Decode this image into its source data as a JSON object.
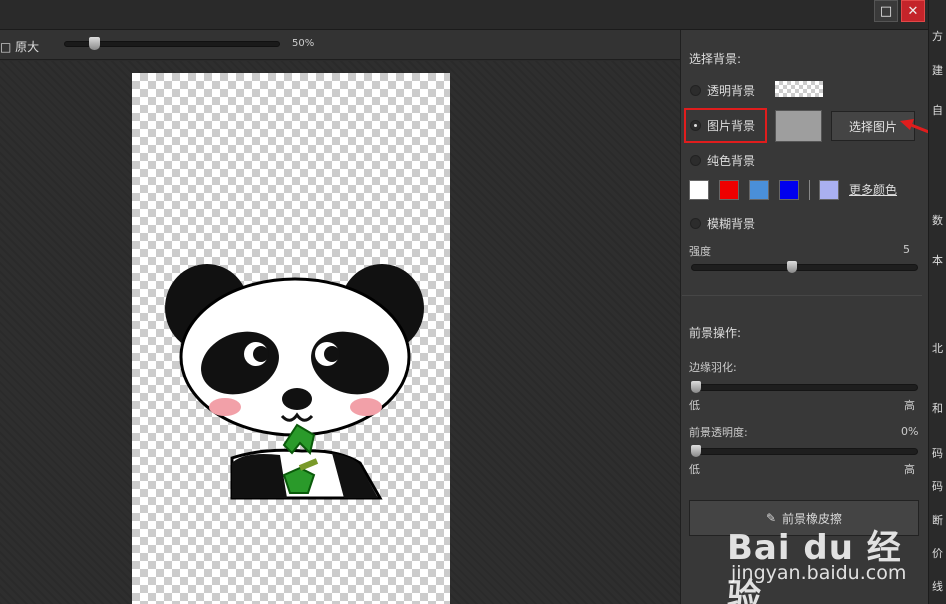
{
  "window": {
    "maximize_icon": "maximize-icon",
    "close_icon": "close-icon"
  },
  "canvas_toolbar": {
    "original_size_label": "原大",
    "zoom_value": "50%",
    "zoom_fraction": 0.14
  },
  "panel": {
    "background_section_title": "选择背景:",
    "options": {
      "transparent": "透明背景",
      "image": "图片背景",
      "solid": "纯色背景",
      "blur": "模糊背景"
    },
    "selected_option": "image",
    "select_image_button": "选择图片",
    "solid_swatches": [
      "#ffffff",
      "#ee0000",
      "#4a8fd8",
      "#0000ee",
      "#aab0f0"
    ],
    "image_swatch_color": "#9e9e9e",
    "more_colors_link": "更多颜色",
    "strength_label": "强度",
    "strength_value": "5",
    "foreground_section_title": "前景操作:",
    "edge_feather_label": "边缘羽化:",
    "edge_low": "低",
    "edge_high": "高",
    "opacity_label": "前景透明度:",
    "opacity_value": "0%",
    "opacity_low": "低",
    "opacity_high": "高",
    "eraser_button": "前景橡皮擦",
    "eraser_icon": "eraser-icon"
  },
  "strip_chars": [
    "方",
    "建",
    "自",
    "数",
    "本",
    "北",
    "和",
    "码",
    "码",
    "断",
    "价",
    "线"
  ],
  "watermark": {
    "logo": "Bai du 经验",
    "url": "jingyan.baidu.com"
  },
  "colors": {
    "highlight": "#e01d1d",
    "arrow": "#e01d1d"
  }
}
